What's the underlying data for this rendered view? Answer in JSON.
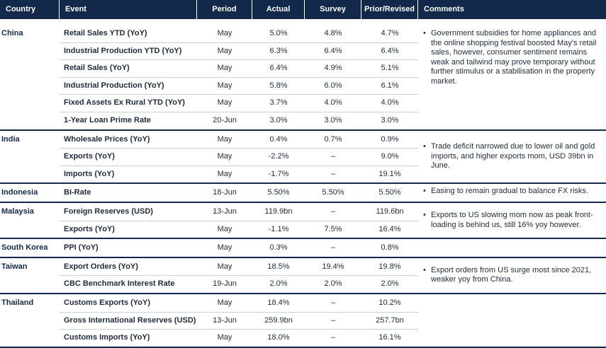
{
  "header": {
    "country": "Country",
    "event": "Event",
    "period": "Period",
    "actual": "Actual",
    "survey": "Survey",
    "prior": "Prior/Revised",
    "comments": "Comments"
  },
  "bullet": "•",
  "groups": [
    {
      "country": "China",
      "rows": [
        {
          "event": "Retail Sales YTD (YoY)",
          "period": "May",
          "actual": "5.0%",
          "survey": "4.8%",
          "prior": "4.7%"
        },
        {
          "event": "Industrial Production YTD (YoY)",
          "period": "May",
          "actual": "6.3%",
          "survey": "6.4%",
          "prior": "6.4%"
        },
        {
          "event": "Retail Sales (YoY)",
          "period": "May",
          "actual": "6.4%",
          "survey": "4.9%",
          "prior": "5.1%"
        },
        {
          "event": "Industrial Production (YoY)",
          "period": "May",
          "actual": "5.8%",
          "survey": "6.0%",
          "prior": "6.1%"
        },
        {
          "event": "Fixed Assets Ex Rural YTD (YoY)",
          "period": "May",
          "actual": "3.7%",
          "survey": "4.0%",
          "prior": "4.0%"
        },
        {
          "event": "1-Year Loan Prime Rate",
          "period": "20-Jun",
          "actual": "3.0%",
          "survey": "3.0%",
          "prior": "3.0%"
        }
      ],
      "comment": "Government subsidies for home appliances and the online shopping festival boosted May’s retail sales, however, consumer sentiment remains weak and tailwind may prove temporary without further stimulus or a stabilisation in the property market."
    },
    {
      "country": "India",
      "rows": [
        {
          "event": "Wholesale Prices (YoY)",
          "period": "May",
          "actual": "0.4%",
          "survey": "0.7%",
          "prior": "0.9%"
        },
        {
          "event": "Exports (YoY)",
          "period": "May",
          "actual": "-2.2%",
          "survey": "–",
          "prior": "9.0%"
        },
        {
          "event": "Imports (YoY)",
          "period": "May",
          "actual": "-1.7%",
          "survey": "–",
          "prior": "19.1%"
        }
      ],
      "comment": "Trade deficit narrowed due to lower oil and gold imports, and higher exports mom, USD 39bn in June."
    },
    {
      "country": "Indonesia",
      "rows": [
        {
          "event": "BI-Rate",
          "period": "18-Jun",
          "actual": "5.50%",
          "survey": "5.50%",
          "prior": "5.50%"
        }
      ],
      "comment": "Easing to remain gradual to balance FX risks."
    },
    {
      "country": "Malaysia",
      "rows": [
        {
          "event": "Foreign Reserves (USD)",
          "period": "13-Jun",
          "actual": "119.9bn",
          "survey": "–",
          "prior": "119.6bn"
        },
        {
          "event": "Exports (YoY)",
          "period": "May",
          "actual": "-1.1%",
          "survey": "7.5%",
          "prior": "16.4%"
        }
      ],
      "comment": "Exports to US slowing mom now as peak front-loading is behind us, still 16% yoy however."
    },
    {
      "country": "South Korea",
      "rows": [
        {
          "event": "PPI (YoY)",
          "period": "May",
          "actual": "0.3%",
          "survey": "–",
          "prior": "0.8%"
        }
      ],
      "comment": ""
    },
    {
      "country": "Taiwan",
      "rows": [
        {
          "event": "Export Orders (YoY)",
          "period": "May",
          "actual": "18.5%",
          "survey": "19.4%",
          "prior": "19.8%"
        },
        {
          "event": "CBC Benchmark Interest Rate",
          "period": "19-Jun",
          "actual": "2.0%",
          "survey": "2.0%",
          "prior": "2.0%"
        }
      ],
      "comment": "Export orders from US surge most since 2021, weaker yoy from China."
    },
    {
      "country": "Thailand",
      "rows": [
        {
          "event": "Customs Exports (YoY)",
          "period": "May",
          "actual": "18.4%",
          "survey": "–",
          "prior": "10.2%"
        },
        {
          "event": "Gross International Reserves (USD)",
          "period": "13-Jun",
          "actual": "259.9bn",
          "survey": "–",
          "prior": "257.7bn"
        },
        {
          "event": "Customs Imports (YoY)",
          "period": "May",
          "actual": "18.0%",
          "survey": "–",
          "prior": "16.1%"
        }
      ],
      "comment": ""
    }
  ]
}
